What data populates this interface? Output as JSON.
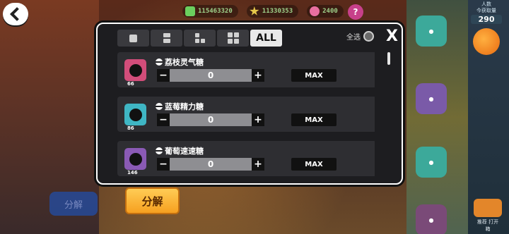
{
  "currencies": [
    {
      "icon": "green-diamond-icon",
      "amount": "115463320"
    },
    {
      "icon": "gold-star-icon",
      "amount": "11330353"
    },
    {
      "icon": "pink-gem-icon",
      "amount": "2400"
    }
  ],
  "help_label": "?",
  "side_panel": {
    "line1": "人数",
    "line2": "今获取量",
    "count": "290",
    "bottom_label": "推荐\n打开箱"
  },
  "background_button_label": "分解",
  "split_button_label": "分解",
  "modal": {
    "tabs": [
      {
        "icon": "single-square-icon",
        "label": ""
      },
      {
        "icon": "two-stack-icon",
        "label": ""
      },
      {
        "icon": "three-block-icon",
        "label": ""
      },
      {
        "icon": "four-grid-icon",
        "label": ""
      },
      {
        "icon": "",
        "label": "ALL"
      }
    ],
    "active_tab": 4,
    "select_all_label": "全选",
    "close_label": "X",
    "items": [
      {
        "name": "荔枝灵气糖",
        "level": "66",
        "thumb_color": "#d24d7a",
        "quantity": "0",
        "minus": "−",
        "plus": "+",
        "max_label": "MAX"
      },
      {
        "name": "蓝莓精力糖",
        "level": "86",
        "thumb_color": "#3fb6c4",
        "quantity": "0",
        "minus": "−",
        "plus": "+",
        "max_label": "MAX"
      },
      {
        "name": "葡萄速速糖",
        "level": "146",
        "thumb_color": "#8a5ab5",
        "quantity": "0",
        "minus": "−",
        "plus": "+",
        "max_label": "MAX"
      }
    ]
  }
}
